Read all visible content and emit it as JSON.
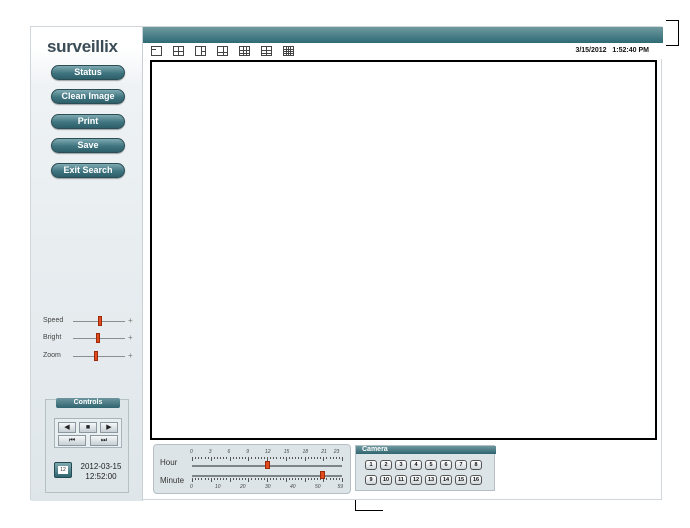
{
  "app": {
    "logo": "surveillix",
    "datetime": "3/15/2012   1:52:40 PM"
  },
  "sidebar": {
    "buttons": [
      {
        "id": "status",
        "label": "Status"
      },
      {
        "id": "clean-image",
        "label": "Clean Image"
      },
      {
        "id": "print",
        "label": "Print"
      },
      {
        "id": "save",
        "label": "Save"
      },
      {
        "id": "exit-search",
        "label": "Exit Search"
      }
    ],
    "sliders": [
      {
        "label": "Speed",
        "value": 0.52
      },
      {
        "label": "Bright",
        "value": 0.48
      },
      {
        "label": "Zoom",
        "value": 0.44
      }
    ],
    "slider_plus": "+"
  },
  "controls": {
    "title": "Controls",
    "buttons": [
      {
        "id": "prev",
        "icon": "play-back-icon",
        "glyph": "◀"
      },
      {
        "id": "stop",
        "icon": "stop-icon",
        "glyph": "■"
      },
      {
        "id": "play",
        "icon": "play-icon",
        "glyph": "▶"
      },
      {
        "id": "first",
        "icon": "skip-back-icon",
        "glyph": "⏮"
      },
      {
        "id": "last",
        "icon": "skip-forward-icon",
        "glyph": "⏭"
      }
    ],
    "date": "2012-03-15",
    "time": "12:52:00",
    "calendar_glyph": "12"
  },
  "layouts": [
    {
      "id": "1x1",
      "icon": "layout-single-icon"
    },
    {
      "id": "2x2",
      "icon": "layout-quad-icon"
    },
    {
      "id": "1p5",
      "icon": "layout-1plus5-icon"
    },
    {
      "id": "1p7",
      "icon": "layout-1plus7-icon"
    },
    {
      "id": "3x3",
      "icon": "layout-nine-icon"
    },
    {
      "id": "1p12",
      "icon": "layout-1plus12-icon"
    },
    {
      "id": "4x4",
      "icon": "layout-sixteen-icon"
    }
  ],
  "timeline": {
    "hour_label": "Hour",
    "minute_label": "Minute",
    "hour_ticks": [
      "0",
      "3",
      "6",
      "9",
      "12",
      "15",
      "18",
      "21",
      "23"
    ],
    "minute_ticks": [
      "0",
      "10",
      "20",
      "30",
      "40",
      "50",
      "59"
    ],
    "hour_value": 12,
    "minute_value": 52
  },
  "camera": {
    "title": "Camera",
    "channels": [
      "1",
      "2",
      "3",
      "4",
      "5",
      "6",
      "7",
      "8",
      "9",
      "10",
      "11",
      "12",
      "13",
      "14",
      "15",
      "16"
    ]
  },
  "colors": {
    "accent": "#2e6a75",
    "thumb": "#e04a1c"
  }
}
